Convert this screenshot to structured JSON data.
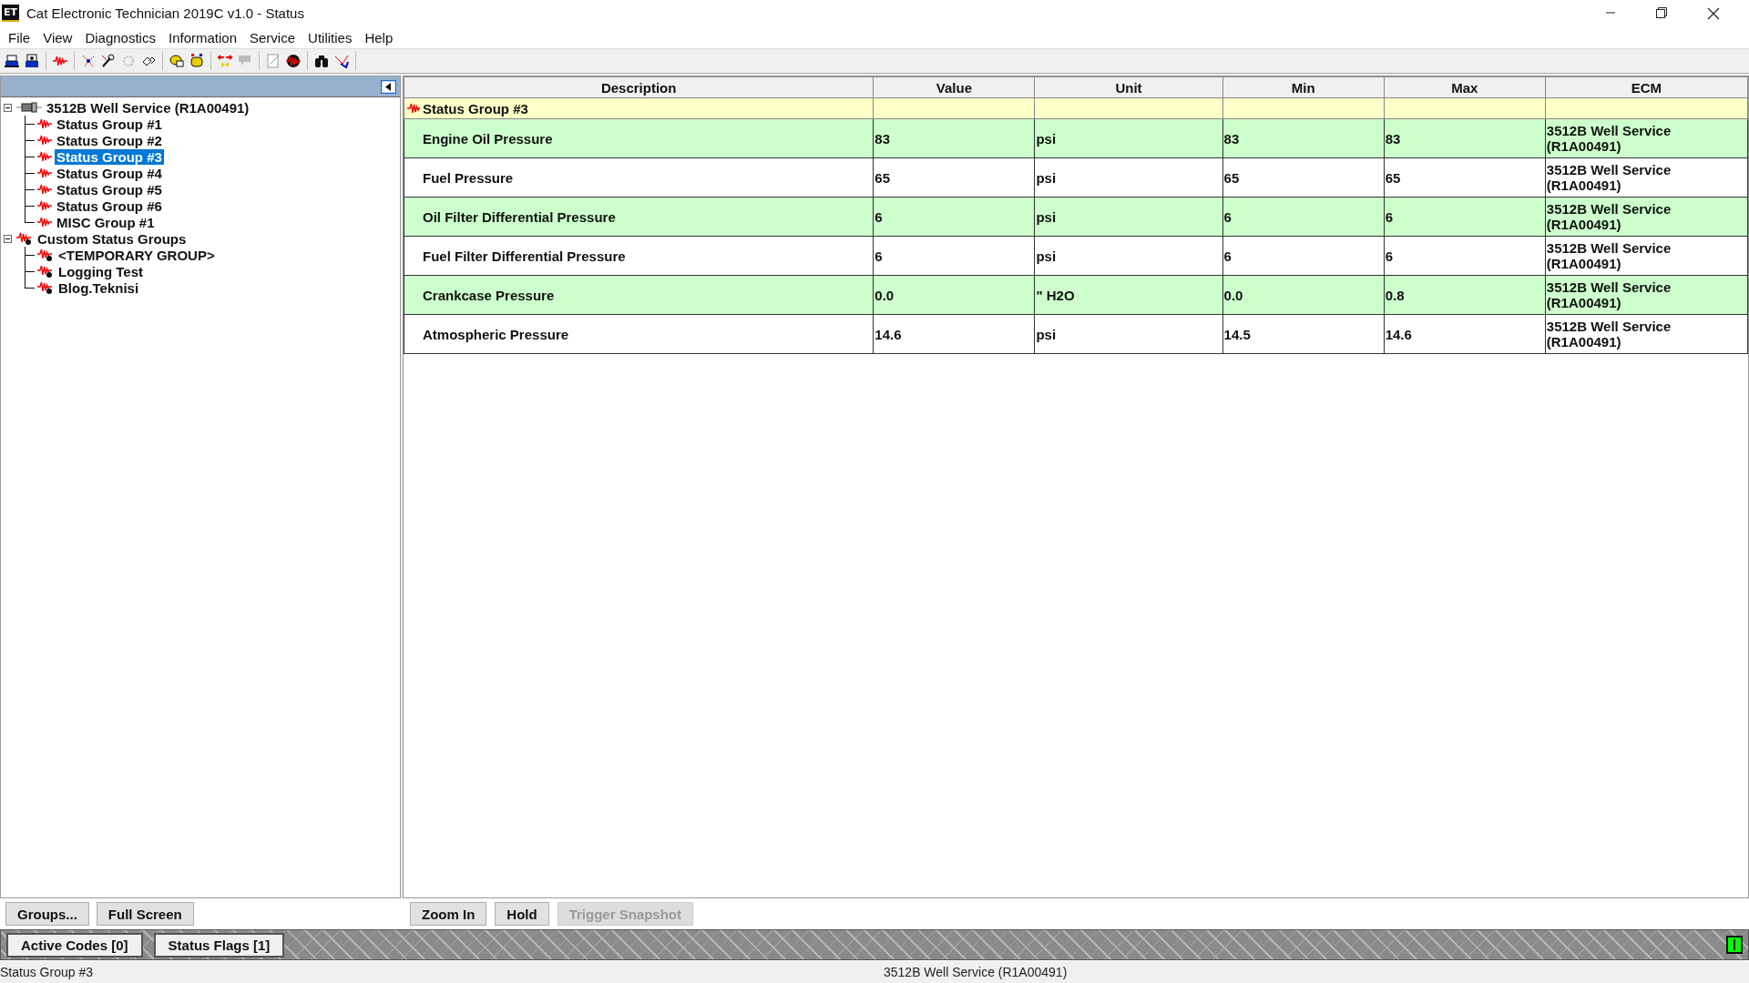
{
  "window": {
    "title": "Cat Electronic Technician 2019C v1.0 - Status",
    "app_badge": "ET"
  },
  "menu": [
    "File",
    "View",
    "Diagnostics",
    "Information",
    "Service",
    "Utilities",
    "Help"
  ],
  "tree": [
    {
      "label": "3512B Well Service (R1A00491)",
      "kind": "ecm",
      "expanded": true,
      "selected": false,
      "children": [
        {
          "label": "Status Group #1",
          "kind": "group",
          "selected": false
        },
        {
          "label": "Status Group #2",
          "kind": "group",
          "selected": false
        },
        {
          "label": "Status Group #3",
          "kind": "group",
          "selected": true
        },
        {
          "label": "Status Group #4",
          "kind": "group",
          "selected": false
        },
        {
          "label": "Status Group #5",
          "kind": "group",
          "selected": false
        },
        {
          "label": "Status Group #6",
          "kind": "group",
          "selected": false
        },
        {
          "label": "MISC Group #1",
          "kind": "group",
          "selected": false
        }
      ]
    },
    {
      "label": "Custom Status Groups",
      "kind": "custom",
      "expanded": true,
      "selected": false,
      "children": [
        {
          "label": "<TEMPORARY GROUP>",
          "kind": "custom",
          "selected": false
        },
        {
          "label": "Logging Test",
          "kind": "custom",
          "selected": false
        },
        {
          "label": "Blog.Teknisi",
          "kind": "custom",
          "selected": false
        }
      ]
    }
  ],
  "table": {
    "columns": [
      "Description",
      "Value",
      "Unit",
      "Min",
      "Max",
      "ECM"
    ],
    "group_row": "Status Group #3",
    "rows": [
      {
        "description": "Engine Oil Pressure",
        "value": "83",
        "unit": "psi",
        "min": "83",
        "max": "83",
        "ecm": "3512B Well Service (R1A00491)"
      },
      {
        "description": "Fuel Pressure",
        "value": "65",
        "unit": "psi",
        "min": "65",
        "max": "65",
        "ecm": "3512B Well Service (R1A00491)"
      },
      {
        "description": "Oil Filter Differential Pressure",
        "value": "6",
        "unit": "psi",
        "min": "6",
        "max": "6",
        "ecm": "3512B Well Service (R1A00491)"
      },
      {
        "description": "Fuel Filter Differential Pressure",
        "value": "6",
        "unit": "psi",
        "min": "6",
        "max": "6",
        "ecm": "3512B Well Service (R1A00491)"
      },
      {
        "description": "Crankcase Pressure",
        "value": "0.0",
        "unit": "\" H2O",
        "min": "0.0",
        "max": "0.8",
        "ecm": "3512B Well Service (R1A00491)"
      },
      {
        "description": "Atmospheric Pressure",
        "value": "14.6",
        "unit": "psi",
        "min": "14.5",
        "max": "14.6",
        "ecm": "3512B Well Service (R1A00491)"
      }
    ]
  },
  "left_buttons": [
    {
      "label": "Groups...",
      "disabled": false
    },
    {
      "label": "Full Screen",
      "disabled": false
    }
  ],
  "right_buttons": [
    {
      "label": "Zoom In",
      "disabled": false
    },
    {
      "label": "Hold",
      "disabled": false
    },
    {
      "label": "Trigger Snapshot",
      "disabled": true
    }
  ],
  "code_buttons": [
    "Active Codes [0]",
    "Status Flags [1]"
  ],
  "indicator": {
    "on": true
  },
  "status_bar": {
    "left": "Status Group #3",
    "right": "3512B Well Service (R1A00491)"
  }
}
